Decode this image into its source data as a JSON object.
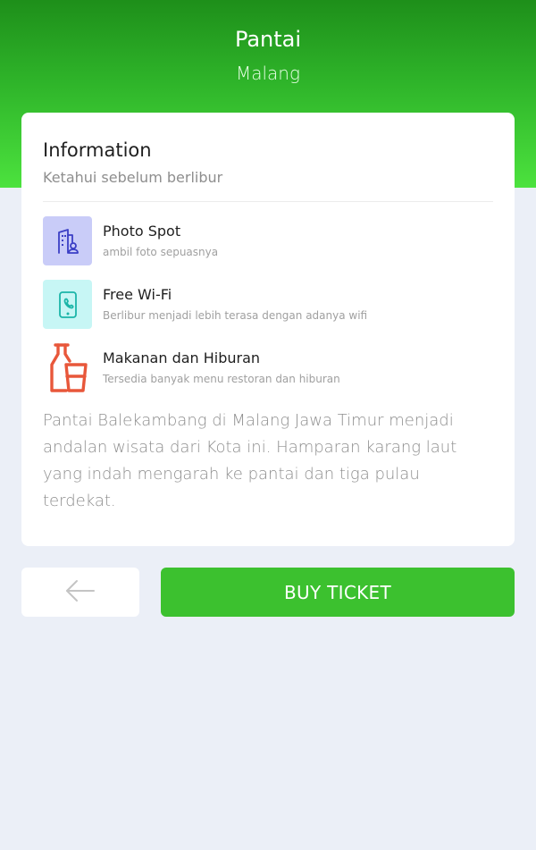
{
  "header": {
    "title": "Pantai",
    "subtitle": "Malang"
  },
  "info": {
    "title": "Information",
    "subtitle": "Ketahui sebelum berlibur"
  },
  "features": [
    {
      "title": "Photo Spot",
      "desc": "ambil foto sepuasnya",
      "icon": "photo-spot-icon",
      "bg": "#C9CCF8",
      "color": "#3B3FC5"
    },
    {
      "title": "Free Wi-Fi",
      "desc": "Berlibur menjadi lebih terasa dengan adanya wifi",
      "icon": "phone-icon",
      "bg": "#C7F6F5",
      "color": "#1BB5A8"
    },
    {
      "title": "Makanan dan Hiburan",
      "desc": "Tersedia banyak menu restoran dan hiburan",
      "icon": "bottle-glass-icon",
      "bg": "#FFFFFF",
      "color": "#E8573A"
    }
  ],
  "description": "Pantai Balekambang di Malang Jawa Timur menjadi andalan wisata  dari Kota ini.  Hamparan karang laut yang indah mengarah ke pantai dan tiga pulau terdekat.",
  "actions": {
    "back_icon": "arrow-left-icon",
    "buy_label": "BUY TICKET"
  },
  "colors": {
    "accent": "#3CC12F",
    "background": "#EBEFF7"
  }
}
